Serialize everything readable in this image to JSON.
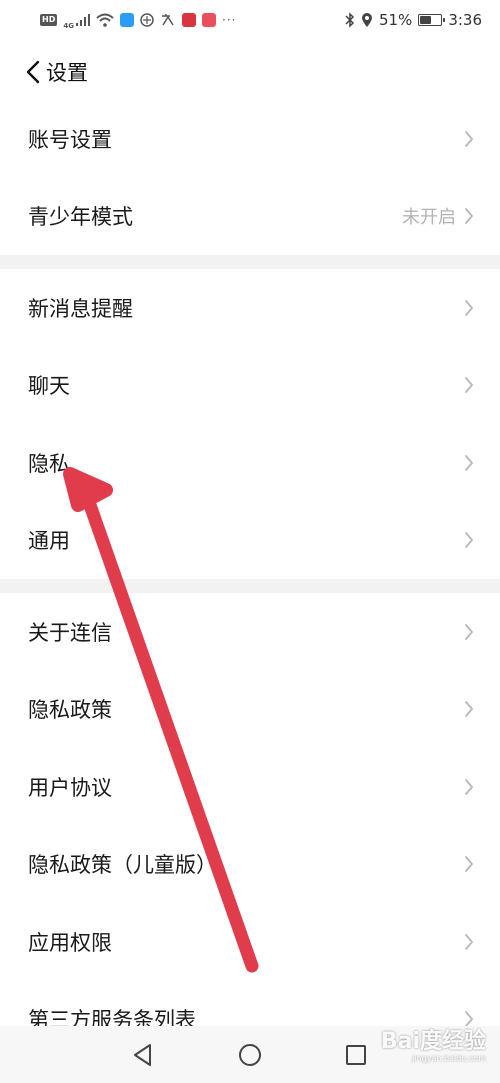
{
  "status_bar": {
    "hd_badge": "HD",
    "network": "4G",
    "battery_percent": "51%",
    "battery_level": 0.51,
    "time": "3:36",
    "more": "···"
  },
  "header": {
    "title": "设置",
    "back_icon": "chevron-left-icon"
  },
  "groups": [
    {
      "items": [
        {
          "label": "账号设置",
          "value": ""
        },
        {
          "label": "青少年模式",
          "value": "未开启"
        }
      ]
    },
    {
      "items": [
        {
          "label": "新消息提醒",
          "value": ""
        },
        {
          "label": "聊天",
          "value": ""
        },
        {
          "label": "隐私",
          "value": ""
        },
        {
          "label": "通用",
          "value": ""
        }
      ]
    },
    {
      "items": [
        {
          "label": "关于连信",
          "value": ""
        },
        {
          "label": "隐私政策",
          "value": ""
        },
        {
          "label": "用户协议",
          "value": ""
        },
        {
          "label": "隐私政策（儿童版）",
          "value": ""
        },
        {
          "label": "应用权限",
          "value": ""
        },
        {
          "label": "第三方服务条列表",
          "value": ""
        }
      ]
    }
  ],
  "nav_bar": {
    "back_icon": "triangle-back-icon",
    "home_icon": "circle-home-icon",
    "recents_icon": "square-recents-icon"
  },
  "watermark": {
    "main": "Bai度经验",
    "sub": "jingyan.baidu.com"
  },
  "colors": {
    "arrow": "#e03c4c",
    "chevron": "#b8b8b8",
    "secondary_text": "#b3b3b3",
    "divider_gap": "#f2f2f2"
  }
}
